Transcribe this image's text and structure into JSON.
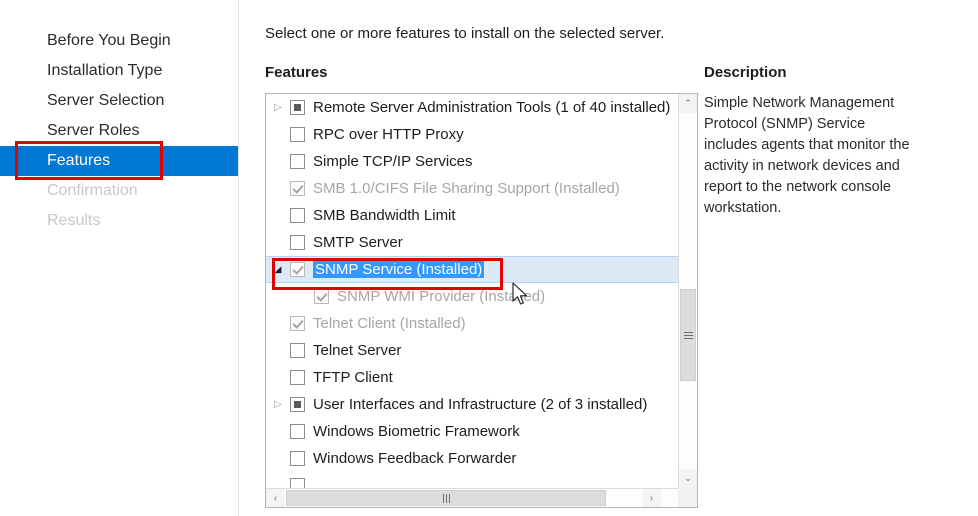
{
  "sidebar": {
    "items": [
      {
        "label": "Before You Begin",
        "state": "normal"
      },
      {
        "label": "Installation Type",
        "state": "normal"
      },
      {
        "label": "Server Selection",
        "state": "normal"
      },
      {
        "label": "Server Roles",
        "state": "normal"
      },
      {
        "label": "Features",
        "state": "active"
      },
      {
        "label": "Confirmation",
        "state": "disabled"
      },
      {
        "label": "Results",
        "state": "disabled"
      }
    ],
    "active_color": "#0078d4"
  },
  "content": {
    "instruction": "Select one or more features to install on the selected server.",
    "features_label": "Features"
  },
  "features_list": {
    "rows": [
      {
        "label": "Remote Server Administration Tools (1 of 40 installed)",
        "checkbox": "partial",
        "indent": 0,
        "expander": "expand",
        "dim": false,
        "selected": false,
        "text_highlight": false
      },
      {
        "label": "RPC over HTTP Proxy",
        "checkbox": "unchecked",
        "indent": 0,
        "expander": "none",
        "dim": false,
        "selected": false,
        "text_highlight": false
      },
      {
        "label": "Simple TCP/IP Services",
        "checkbox": "unchecked",
        "indent": 0,
        "expander": "none",
        "dim": false,
        "selected": false,
        "text_highlight": false
      },
      {
        "label": "SMB 1.0/CIFS File Sharing Support (Installed)",
        "checkbox": "checked-disabled",
        "indent": 0,
        "expander": "none",
        "dim": true,
        "selected": false,
        "text_highlight": false
      },
      {
        "label": "SMB Bandwidth Limit",
        "checkbox": "unchecked",
        "indent": 0,
        "expander": "none",
        "dim": false,
        "selected": false,
        "text_highlight": false
      },
      {
        "label": "SMTP Server",
        "checkbox": "unchecked",
        "indent": 0,
        "expander": "none",
        "dim": false,
        "selected": false,
        "text_highlight": false
      },
      {
        "label": "SNMP Service (Installed)",
        "checkbox": "checked-disabled",
        "indent": 0,
        "expander": "collapse",
        "dim": false,
        "selected": true,
        "text_highlight": true
      },
      {
        "label": "SNMP WMI Provider (Installed)",
        "checkbox": "checked-disabled",
        "indent": 1,
        "expander": "none",
        "dim": true,
        "selected": false,
        "text_highlight": false
      },
      {
        "label": "Telnet Client (Installed)",
        "checkbox": "checked-disabled",
        "indent": 0,
        "expander": "none",
        "dim": true,
        "selected": false,
        "text_highlight": false
      },
      {
        "label": "Telnet Server",
        "checkbox": "unchecked",
        "indent": 0,
        "expander": "none",
        "dim": false,
        "selected": false,
        "text_highlight": false
      },
      {
        "label": "TFTP Client",
        "checkbox": "unchecked",
        "indent": 0,
        "expander": "none",
        "dim": false,
        "selected": false,
        "text_highlight": false
      },
      {
        "label": "User Interfaces and Infrastructure (2 of 3 installed)",
        "checkbox": "partial",
        "indent": 0,
        "expander": "expand",
        "dim": false,
        "selected": false,
        "text_highlight": false
      },
      {
        "label": "Windows Biometric Framework",
        "checkbox": "unchecked",
        "indent": 0,
        "expander": "none",
        "dim": false,
        "selected": false,
        "text_highlight": false
      },
      {
        "label": "Windows Feedback Forwarder",
        "checkbox": "unchecked",
        "indent": 0,
        "expander": "none",
        "dim": false,
        "selected": false,
        "text_highlight": false
      },
      {
        "label": "",
        "checkbox": "unchecked",
        "indent": 0,
        "expander": "none",
        "dim": false,
        "selected": false,
        "text_highlight": false
      }
    ],
    "selection_highlight_color": "#3399ff",
    "selected_row_color": "#dce9f7",
    "scrollbar": {
      "up_arrow": "⌃",
      "down_arrow": "⌄",
      "left_arrow": "‹",
      "right_arrow": "›"
    }
  },
  "description": {
    "title": "Description",
    "body": "Simple Network Management Protocol (SNMP) Service includes agents that monitor the activity in network devices and report to the network console workstation."
  },
  "annotations": {
    "color": "#e30000",
    "boxes": [
      "features-nav-item",
      "snmp-service-row"
    ]
  }
}
